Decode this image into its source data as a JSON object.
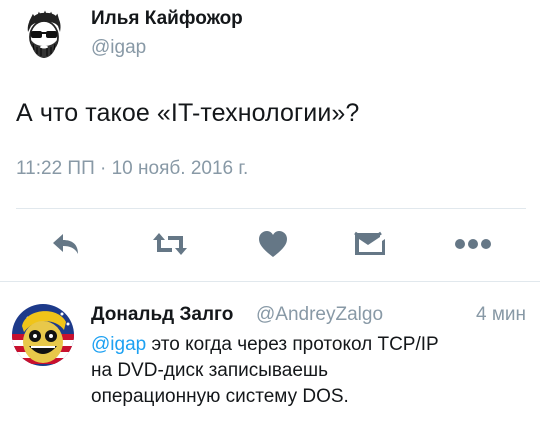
{
  "tweet": {
    "author_name": "Илья Кайфожор",
    "author_handle": "@igap",
    "text": "А что такое «IT-технологии»?",
    "timestamp": "11:22 ПП · 10 нояб. 2016 г."
  },
  "actions": {
    "reply_icon": "reply-arrow-icon",
    "retweet_icon": "retweet-icon",
    "like_icon": "heart-icon",
    "dm_icon": "envelope-icon",
    "more_icon": "more-dots-icon",
    "color": "#657786"
  },
  "reply": {
    "author_name": "Дональд Залго",
    "author_handle": "@AndreyZalgo",
    "time": "4 мин",
    "mention": "@igap",
    "text_line1": " это когда через протокол TCP/IP",
    "text_line2": "на DVD-диск записываешь",
    "text_line3": "операционную систему DOS."
  },
  "colors": {
    "text": "#14171a",
    "secondary": "#8899a6",
    "link": "#1da1f2",
    "divider": "#e1e8ed"
  }
}
